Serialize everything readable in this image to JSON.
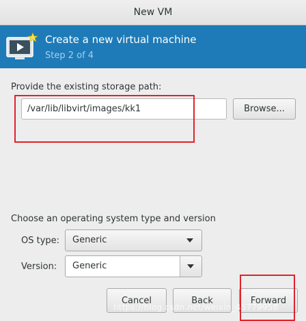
{
  "window": {
    "title": "New VM"
  },
  "header": {
    "title": "Create a new virtual machine",
    "step": "Step 2 of 4"
  },
  "storage": {
    "label": "Provide the existing storage path:",
    "path_value": "/var/lib/libvirt/images/kk1",
    "browse_label": "Browse..."
  },
  "os": {
    "section_label": "Choose an operating system type and version",
    "type_label": "OS type:",
    "type_value": "Generic",
    "version_label": "Version:",
    "version_value": "Generic"
  },
  "buttons": {
    "cancel": "Cancel",
    "back": "Back",
    "forward": "Forward"
  },
  "watermark": "https://blog.csdn.net/weixin_45779958",
  "colors": {
    "header_bg": "#1e7bb8",
    "annotation": "#e0212a"
  }
}
